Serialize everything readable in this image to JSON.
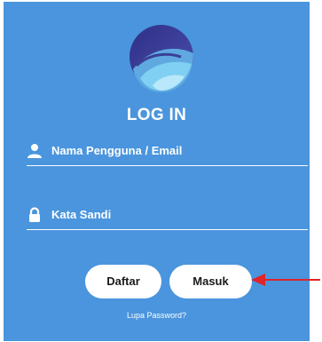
{
  "colors": {
    "background": "#4a95dd",
    "text": "#ffffff",
    "button_bg": "#ffffff",
    "button_text": "#1a1a1a",
    "arrow": "#e0242a",
    "logo_dark": "#3a3f97",
    "logo_light": "#6fc4ee"
  },
  "header": {
    "title": "LOG IN"
  },
  "form": {
    "username": {
      "placeholder": "Nama Pengguna / Email",
      "icon": "user-icon"
    },
    "password": {
      "placeholder": "Kata Sandi",
      "icon": "lock-icon"
    }
  },
  "buttons": {
    "register": "Daftar",
    "login": "Masuk"
  },
  "links": {
    "forgot_password": "Lupa Password?"
  },
  "annotation": {
    "icon": "arrow-left-icon"
  }
}
